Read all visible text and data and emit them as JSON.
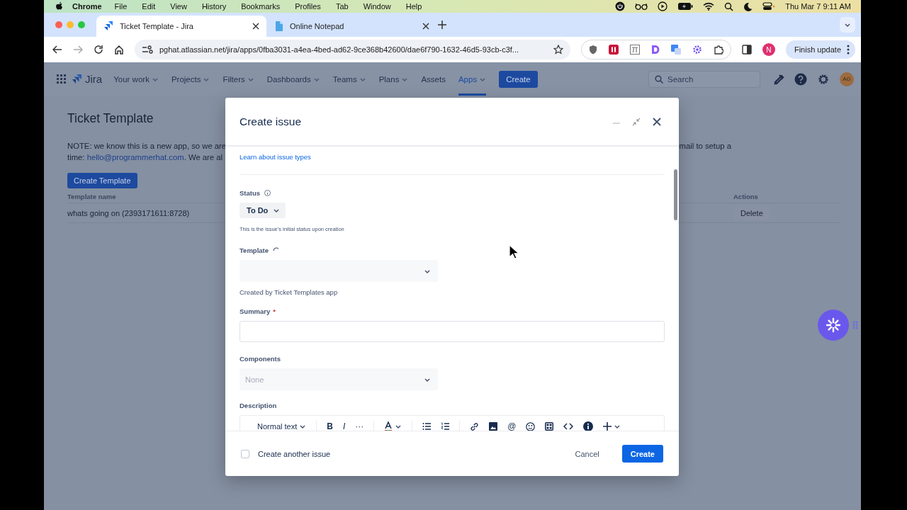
{
  "menubar": {
    "app": "Chrome",
    "menus": [
      "File",
      "Edit",
      "View",
      "History",
      "Bookmarks",
      "Profiles",
      "Tab",
      "Window",
      "Help"
    ],
    "clock": "Thu Mar 7  9:11 AM"
  },
  "browser": {
    "tabs": [
      {
        "title": "Ticket Template - Jira",
        "selected": true,
        "kind": "jira"
      },
      {
        "title": "Online Notepad",
        "selected": false,
        "kind": "notepad"
      }
    ],
    "url": "pghat.atlassian.net/jira/apps/0fba3031-a4ea-4bed-ad62-9ce368b42600/dae6f790-1632-46d5-93cb-c3f...",
    "profile": "N",
    "update_button": "Finish update"
  },
  "jira": {
    "product": "Jira",
    "nav": [
      {
        "label": "Your work",
        "dropdown": true,
        "selected": false
      },
      {
        "label": "Projects",
        "dropdown": true,
        "selected": false
      },
      {
        "label": "Filters",
        "dropdown": true,
        "selected": false
      },
      {
        "label": "Dashboards",
        "dropdown": true,
        "selected": false
      },
      {
        "label": "Teams",
        "dropdown": true,
        "selected": false
      },
      {
        "label": "Plans",
        "dropdown": true,
        "selected": false
      },
      {
        "label": "Assets",
        "dropdown": false,
        "selected": false
      },
      {
        "label": "Apps",
        "dropdown": true,
        "selected": true
      }
    ],
    "create": "Create",
    "search_placeholder": "Search",
    "avatar": "AG"
  },
  "page": {
    "title": "Ticket Template",
    "note_line1": "NOTE: we know this is a new app, so we are",
    "note_line2": {
      "before": "time: ",
      "link": "hello@programmerhat.com",
      "after": ". We are al"
    },
    "note_right": "mail to setup a",
    "create_template": "Create Template",
    "table": {
      "columns": [
        "Template name",
        "Actions"
      ],
      "rows": [
        {
          "name": "whats going on (2393171611:8728)",
          "action": "Delete"
        }
      ]
    }
  },
  "modal": {
    "title": "Create issue",
    "learn_link": "Learn about issue types",
    "fields": [
      {
        "kind": "status",
        "label": "Status",
        "value": "To Do",
        "help": "This is the issue's initial status upon creation"
      },
      {
        "kind": "select",
        "label": "Template",
        "loading": true,
        "help": "Created by Ticket Templates app"
      },
      {
        "kind": "text",
        "label": "Summary",
        "required_mark": "*"
      },
      {
        "kind": "select",
        "label": "Components",
        "loading": false,
        "placeholder": "None"
      },
      {
        "kind": "editor",
        "label": "Description",
        "style": "Normal text",
        "marks": [
          "B",
          "I",
          "···"
        ],
        "mention": "@"
      }
    ],
    "footer": {
      "create_another": {
        "label": "Create another issue",
        "checked": false
      },
      "cancel": "Cancel",
      "submit": "Create"
    }
  }
}
